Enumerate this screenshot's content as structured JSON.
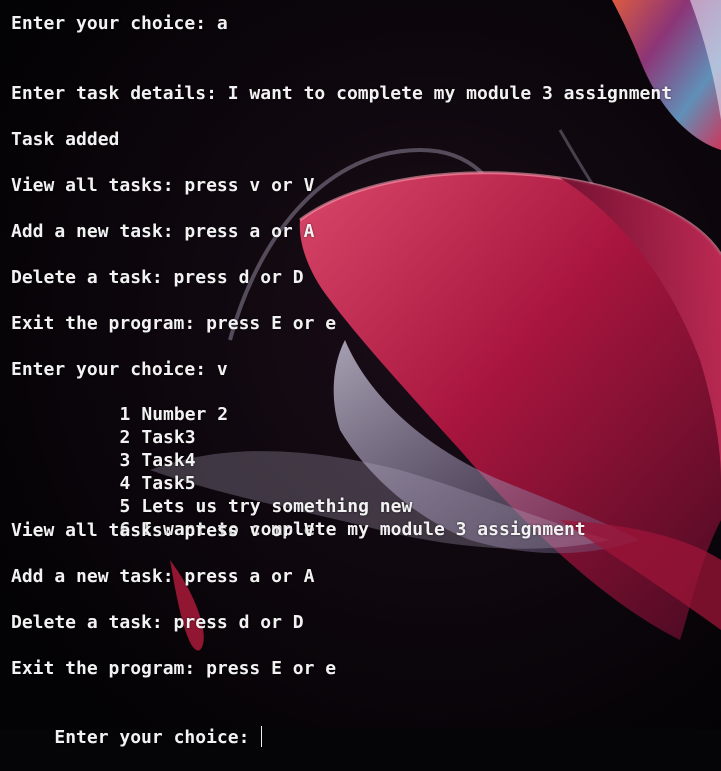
{
  "terminal": {
    "first_prompt": "Enter your choice: a",
    "task_details": "Enter task details: I want to complete my module 3 assignment",
    "task_added": "Task added",
    "menu1": {
      "view": "View all tasks: press v or V",
      "add": "Add a new task: press a or A",
      "delete": "Delete a task: press d or D",
      "exit": "Exit the program: press E or e"
    },
    "second_prompt": "Enter your choice: v",
    "tasks": [
      {
        "num": "1",
        "text": "Number 2"
      },
      {
        "num": "2",
        "text": "Task3"
      },
      {
        "num": "3",
        "text": "Task4"
      },
      {
        "num": "4",
        "text": "Task5"
      },
      {
        "num": "5",
        "text": "Lets us try something new"
      },
      {
        "num": "6",
        "text": "I want to complete my module 3 assignment"
      }
    ],
    "menu2": {
      "view": "View all tasks: press v or V",
      "add": "Add a new task: press a or A",
      "delete": "Delete a task: press d or D",
      "exit": "Exit the program: press E or e"
    },
    "final_prompt": "Enter your choice:"
  },
  "colors": {
    "background": "#050407",
    "text": "#f2f2f2",
    "accent_magenta": "#b0154a"
  }
}
